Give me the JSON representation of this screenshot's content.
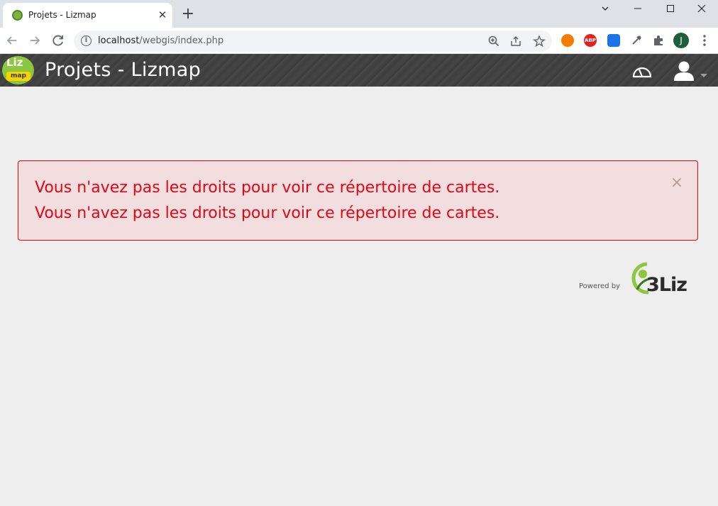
{
  "browser": {
    "tab_title": "Projets - Lizmap",
    "url_host": "localhost",
    "url_path": "/webgis/index.php",
    "profile_initial": "J",
    "extensions": [
      "abp-icon-label"
    ],
    "abp_label": "ABP"
  },
  "header": {
    "title": "Projets - Lizmap",
    "logo_top": "Liz",
    "logo_bottom": "map"
  },
  "alert": {
    "messages": [
      "Vous n'avez pas les droits pour voir ce répertoire de cartes.",
      "Vous n'avez pas les droits pour voir ce répertoire de cartes."
    ],
    "close_label": "×"
  },
  "footer": {
    "powered_by": "Powered by",
    "brand": "3Liz"
  },
  "colors": {
    "alert_text": "#e30613",
    "alert_bg": "#f2dede",
    "logo_green": "#8dc63f"
  }
}
